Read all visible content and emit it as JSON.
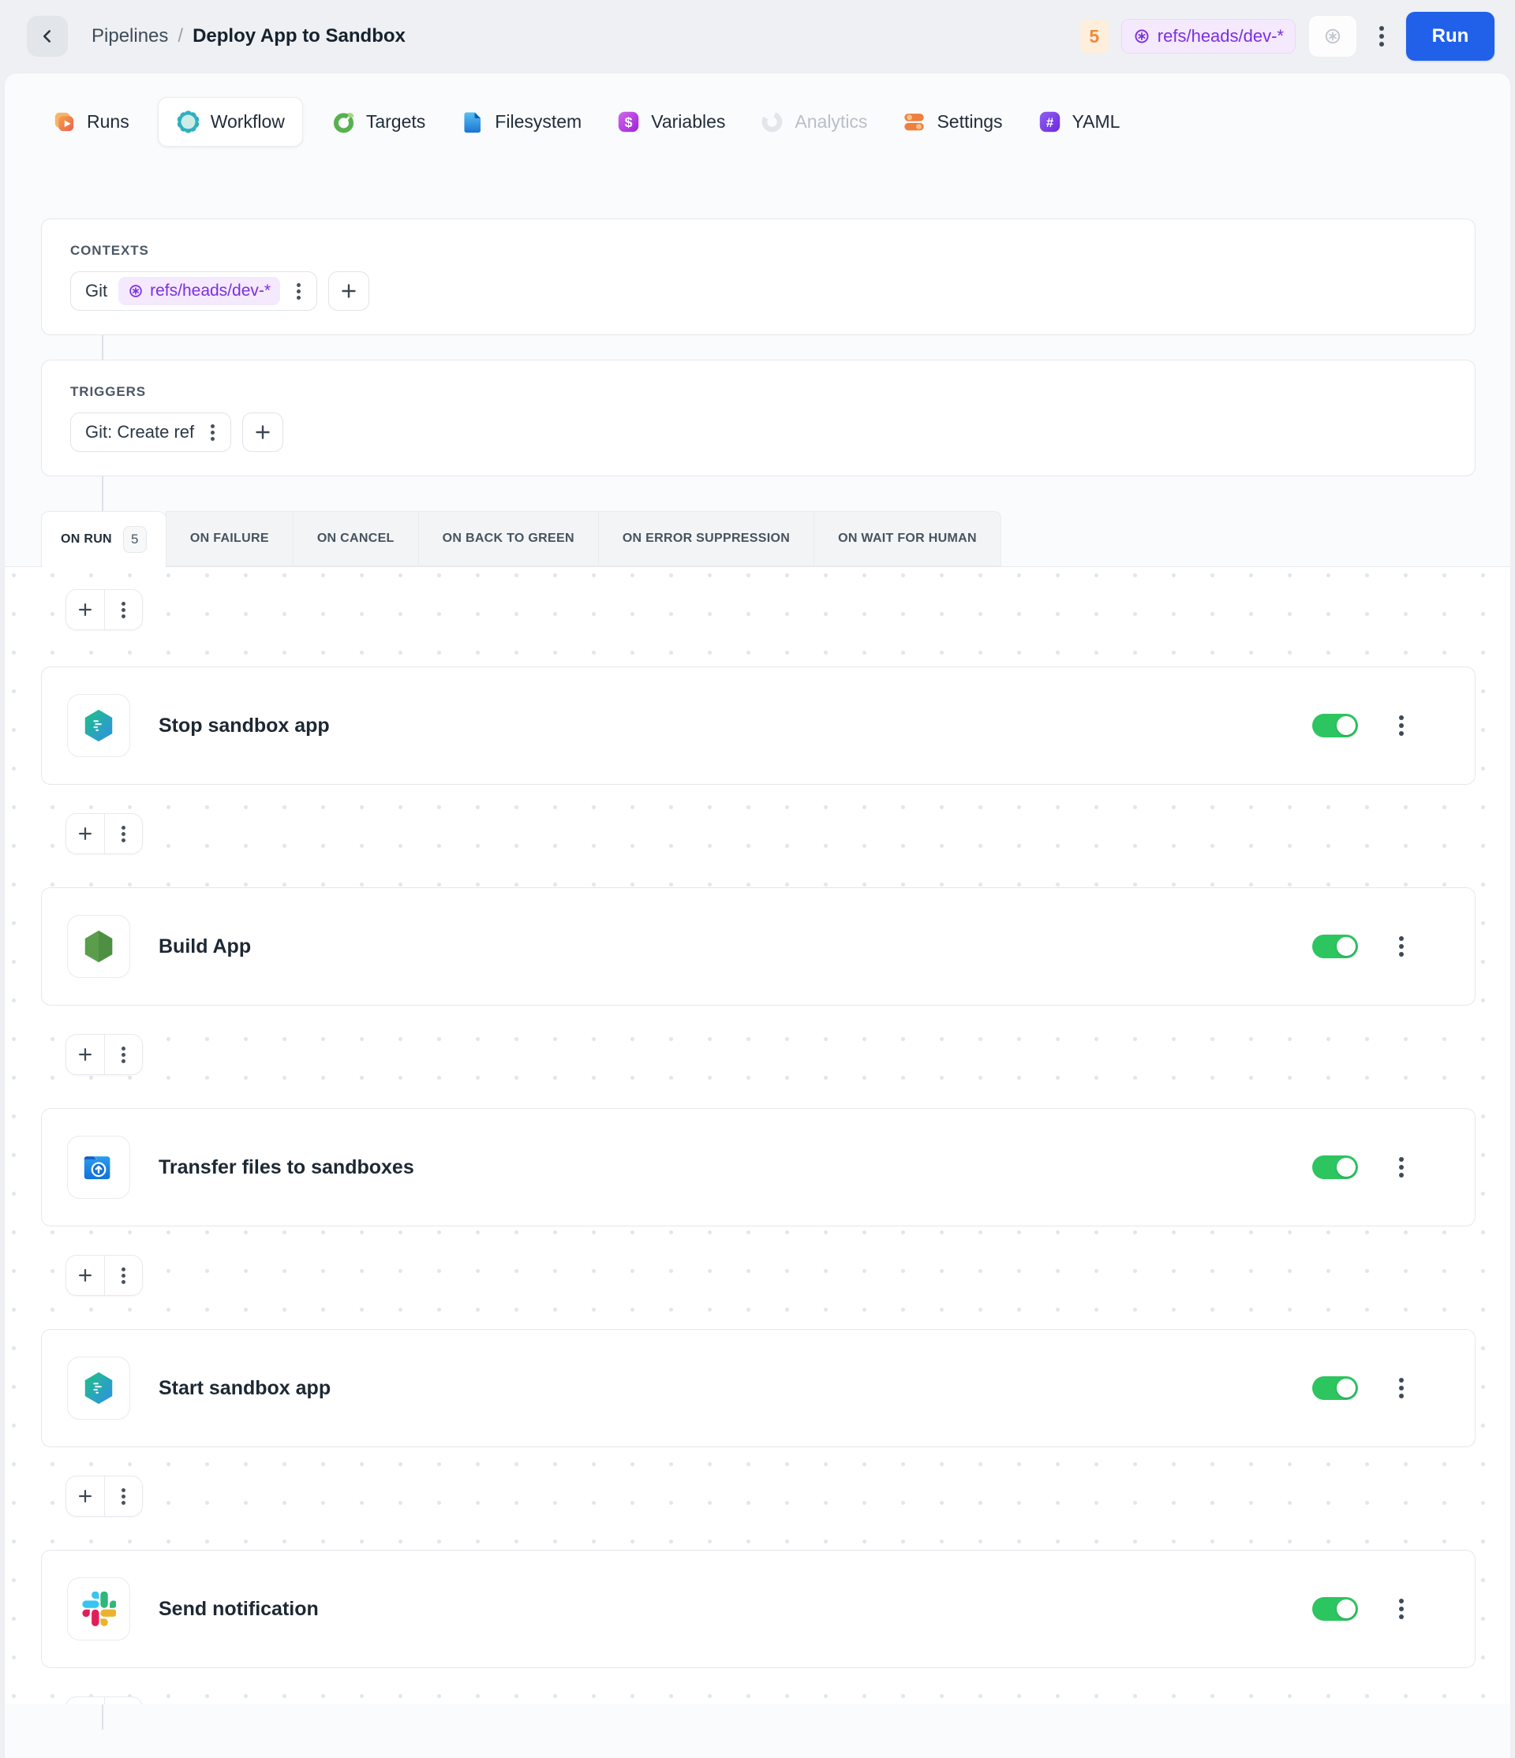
{
  "header": {
    "breadcrumb": {
      "parent": "Pipelines",
      "separator": "/",
      "current": "Deploy App to Sandbox"
    },
    "run_count_badge": "5",
    "ref_badge": "refs/heads/dev-*",
    "run_button": "Run"
  },
  "tabs": [
    {
      "label": "Runs",
      "icon": "runs-icon",
      "active": false,
      "disabled": false
    },
    {
      "label": "Workflow",
      "icon": "workflow-icon",
      "active": true,
      "disabled": false
    },
    {
      "label": "Targets",
      "icon": "targets-icon",
      "active": false,
      "disabled": false
    },
    {
      "label": "Filesystem",
      "icon": "filesystem-icon",
      "active": false,
      "disabled": false
    },
    {
      "label": "Variables",
      "icon": "variables-icon",
      "active": false,
      "disabled": false
    },
    {
      "label": "Analytics",
      "icon": "analytics-icon",
      "active": false,
      "disabled": true
    },
    {
      "label": "Settings",
      "icon": "settings-icon",
      "active": false,
      "disabled": false
    },
    {
      "label": "YAML",
      "icon": "yaml-icon",
      "active": false,
      "disabled": false
    }
  ],
  "contexts": {
    "label": "CONTEXTS",
    "chip": {
      "name": "Git",
      "badge": "refs/heads/dev-*",
      "badge_icon": "git-ref-wildcard-icon"
    }
  },
  "triggers": {
    "label": "TRIGGERS",
    "chip": {
      "name": "Git: Create ref"
    }
  },
  "event_tabs": {
    "active": {
      "label": "ON RUN",
      "count": "5"
    },
    "others": [
      "ON FAILURE",
      "ON CANCEL",
      "ON BACK TO GREEN",
      "ON ERROR SUPPRESSION",
      "ON WAIT FOR HUMAN"
    ]
  },
  "actions": [
    {
      "title": "Stop sandbox app",
      "icon": "sandbox-app-icon",
      "enabled": true
    },
    {
      "title": "Build App",
      "icon": "nodejs-icon",
      "enabled": true
    },
    {
      "title": "Transfer files to sandboxes",
      "icon": "upload-folder-icon",
      "enabled": true
    },
    {
      "title": "Start sandbox app",
      "icon": "sandbox-app-icon",
      "enabled": true
    },
    {
      "title": "Send notification",
      "icon": "slack-icon",
      "enabled": true
    }
  ],
  "colors": {
    "accent_blue": "#2160e8",
    "toggle_green": "#2dc55f",
    "purple_badge_text": "#7b2fe0",
    "purple_badge_bg": "#f4e9fd",
    "orange_badge_text": "#ec8b3d",
    "orange_badge_bg": "#fdefdc",
    "canvas_dot": "#e3e7ec",
    "card_border": "#e4e7ec"
  }
}
